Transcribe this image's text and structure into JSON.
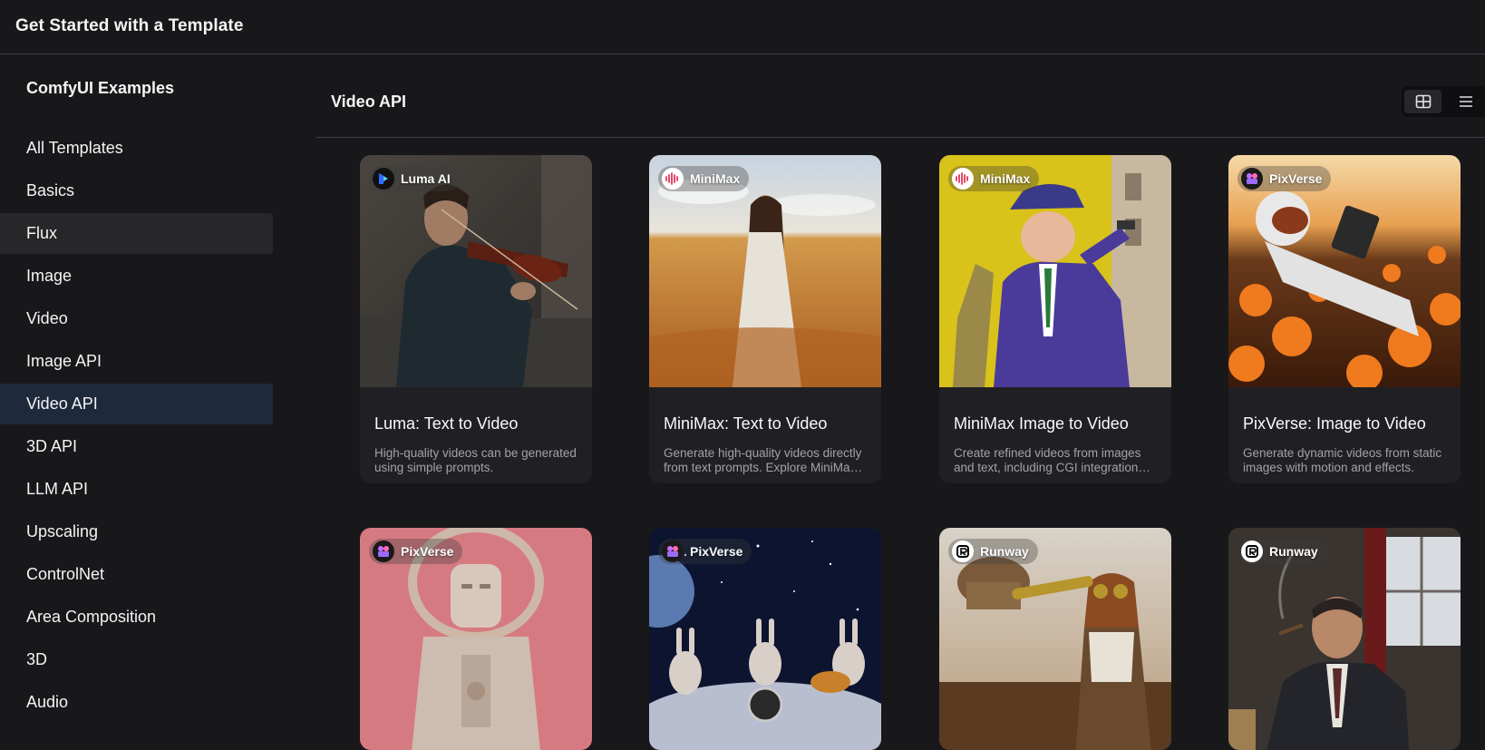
{
  "header": {
    "title": "Get Started with a Template"
  },
  "sidebar": {
    "title": "ComfyUI Examples",
    "items": [
      {
        "label": "All Templates",
        "state": ""
      },
      {
        "label": "Basics",
        "state": ""
      },
      {
        "label": "Flux",
        "state": "hover"
      },
      {
        "label": "Image",
        "state": ""
      },
      {
        "label": "Video",
        "state": ""
      },
      {
        "label": "Image API",
        "state": ""
      },
      {
        "label": "Video API",
        "state": "active"
      },
      {
        "label": "3D API",
        "state": ""
      },
      {
        "label": "LLM API",
        "state": ""
      },
      {
        "label": "Upscaling",
        "state": ""
      },
      {
        "label": "ControlNet",
        "state": ""
      },
      {
        "label": "Area Composition",
        "state": ""
      },
      {
        "label": "3D",
        "state": ""
      },
      {
        "label": "Audio",
        "state": ""
      }
    ]
  },
  "main": {
    "title": "Video API",
    "view_toggle": {
      "grid_icon": "grid-view-icon",
      "list_icon": "list-view-icon",
      "selected": "grid"
    }
  },
  "cards": [
    {
      "provider": "Luma AI",
      "title": "Luma: Text to Video",
      "description": "High-quality videos can be generated using simple prompts."
    },
    {
      "provider": "MiniMax",
      "title": "MiniMax: Text to Video",
      "description": "Generate high-quality videos directly from text prompts. Explore MiniMax's advanced AI capabilities."
    },
    {
      "provider": "MiniMax",
      "title": "MiniMax Image to Video",
      "description": "Create refined videos from images and text, including CGI integration and trendy effects."
    },
    {
      "provider": "PixVerse",
      "title": "PixVerse: Image to Video",
      "description": "Generate dynamic videos from static images with motion and effects."
    },
    {
      "provider": "PixVerse",
      "title": "",
      "description": ""
    },
    {
      "provider": "PixVerse",
      "title": "",
      "description": ""
    },
    {
      "provider": "Runway",
      "title": "",
      "description": ""
    },
    {
      "provider": "Runway",
      "title": "",
      "description": ""
    }
  ]
}
